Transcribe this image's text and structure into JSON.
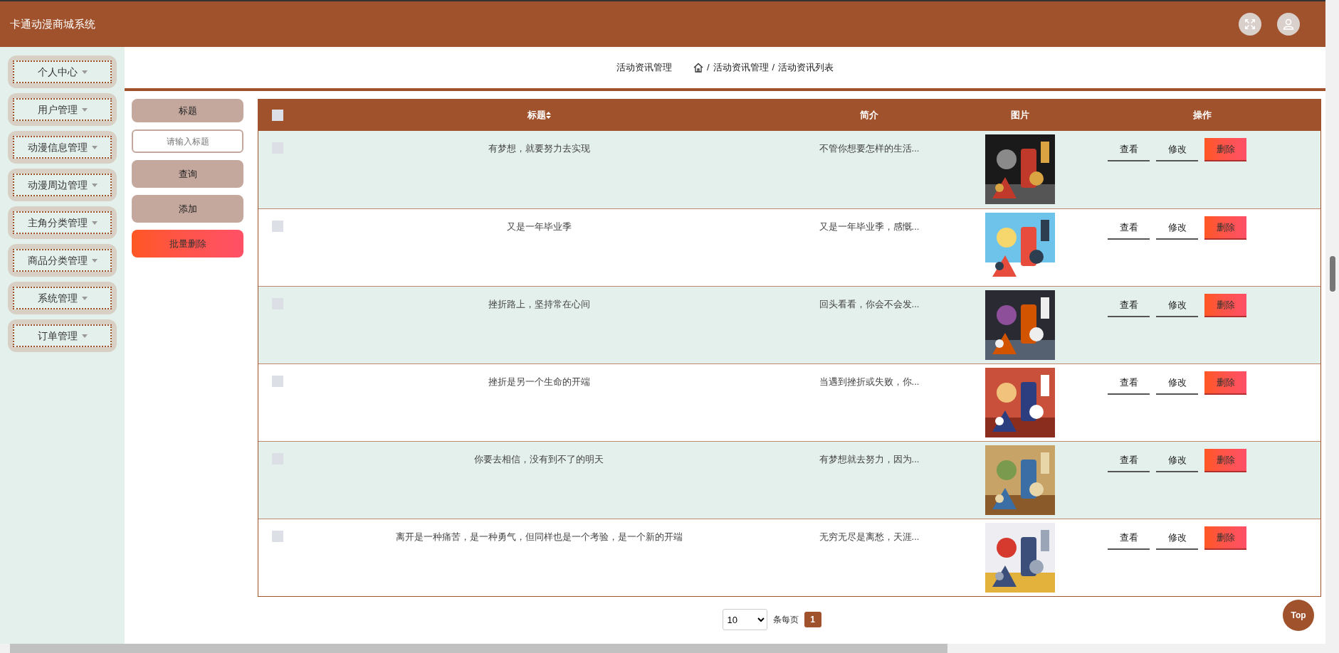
{
  "header": {
    "title": "卡通动漫商城系统"
  },
  "sidebar": {
    "items": [
      {
        "label": "个人中心"
      },
      {
        "label": "用户管理"
      },
      {
        "label": "动漫信息管理"
      },
      {
        "label": "动漫周边管理"
      },
      {
        "label": "主角分类管理"
      },
      {
        "label": "商品分类管理"
      },
      {
        "label": "系统管理"
      },
      {
        "label": "订单管理"
      }
    ]
  },
  "breadcrumb": {
    "page_title": "活动资讯管理",
    "separator": "/",
    "trail": [
      "活动资讯管理",
      "活动资讯列表"
    ]
  },
  "search": {
    "label": "标题",
    "placeholder": "请输入标题",
    "buttons": [
      {
        "label": "查询",
        "kind": "default"
      },
      {
        "label": "添加",
        "kind": "default"
      },
      {
        "label": "批量删除",
        "kind": "danger"
      }
    ]
  },
  "table": {
    "select_all_checked": false,
    "columns": [
      {
        "label": "标题",
        "sortable": true
      },
      {
        "label": "简介",
        "sortable": false
      },
      {
        "label": "图片",
        "sortable": false
      },
      {
        "label": "操作",
        "sortable": false
      }
    ],
    "rows": [
      {
        "checked": false,
        "title": "有梦想，就要努力去实现",
        "summary": "不管你想要怎样的生活...",
        "image": {
          "kind": "picture"
        },
        "actions": [
          {
            "label": "查看",
            "kind": "plain"
          },
          {
            "label": "修改",
            "kind": "plain"
          },
          {
            "label": "删除",
            "kind": "danger"
          }
        ]
      },
      {
        "checked": false,
        "title": "又是一年毕业季",
        "summary": "又是一年毕业季，感慨...",
        "image": {
          "kind": "picture"
        },
        "actions": [
          {
            "label": "查看",
            "kind": "plain"
          },
          {
            "label": "修改",
            "kind": "plain"
          },
          {
            "label": "删除",
            "kind": "danger"
          }
        ]
      },
      {
        "checked": false,
        "title": "挫折路上，坚持常在心间",
        "summary": "回头看看，你会不会发...",
        "image": {
          "kind": "picture"
        },
        "actions": [
          {
            "label": "查看",
            "kind": "plain"
          },
          {
            "label": "修改",
            "kind": "plain"
          },
          {
            "label": "删除",
            "kind": "danger"
          }
        ]
      },
      {
        "checked": false,
        "title": "挫折是另一个生命的开端",
        "summary": "当遇到挫折或失败，你...",
        "image": {
          "kind": "picture"
        },
        "actions": [
          {
            "label": "查看",
            "kind": "plain"
          },
          {
            "label": "修改",
            "kind": "plain"
          },
          {
            "label": "删除",
            "kind": "danger"
          }
        ]
      },
      {
        "checked": false,
        "title": "你要去相信，没有到不了的明天",
        "summary": "有梦想就去努力，因为...",
        "image": {
          "kind": "picture"
        },
        "actions": [
          {
            "label": "查看",
            "kind": "plain"
          },
          {
            "label": "修改",
            "kind": "plain"
          },
          {
            "label": "删除",
            "kind": "danger"
          }
        ]
      },
      {
        "checked": false,
        "title": "离开是一种痛苦，是一种勇气，但同样也是一个考验，是一个新的开端",
        "summary": "无穷无尽是离愁，天涯...",
        "image": {
          "kind": "picture"
        },
        "actions": [
          {
            "label": "查看",
            "kind": "plain"
          },
          {
            "label": "修改",
            "kind": "plain"
          },
          {
            "label": "删除",
            "kind": "danger"
          }
        ]
      }
    ]
  },
  "pagination": {
    "page_size": "10",
    "unit": "条每页",
    "pages": [
      {
        "label": "1",
        "selected": true
      }
    ]
  },
  "top_button": {
    "label": "Top"
  }
}
